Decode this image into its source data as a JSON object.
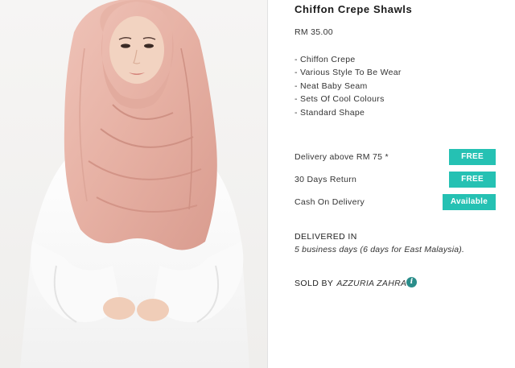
{
  "product": {
    "title": "Chiffon Crepe Shawls",
    "price": "RM 35.00",
    "features": [
      "- Chiffon Crepe",
      "- Various Style To Be Wear",
      "- Neat Baby Seam",
      "- Sets Of Cool Colours",
      "- Standard Shape"
    ]
  },
  "services": [
    {
      "label": "Delivery above RM 75 *",
      "badge": "FREE"
    },
    {
      "label": "30 Days Return",
      "badge": "FREE"
    },
    {
      "label": "Cash On Delivery",
      "badge": "Available"
    }
  ],
  "delivery": {
    "title": "DELIVERED IN",
    "text": "5 business days (6 days for East Malaysia)."
  },
  "seller": {
    "label": "SOLD BY",
    "name": "AZZURIA ZAHRA",
    "icon": "info-icon"
  },
  "colors": {
    "badge": "#25c1b3",
    "info_icon": "#2a8d8a",
    "shawl": "#e9b5a9"
  }
}
